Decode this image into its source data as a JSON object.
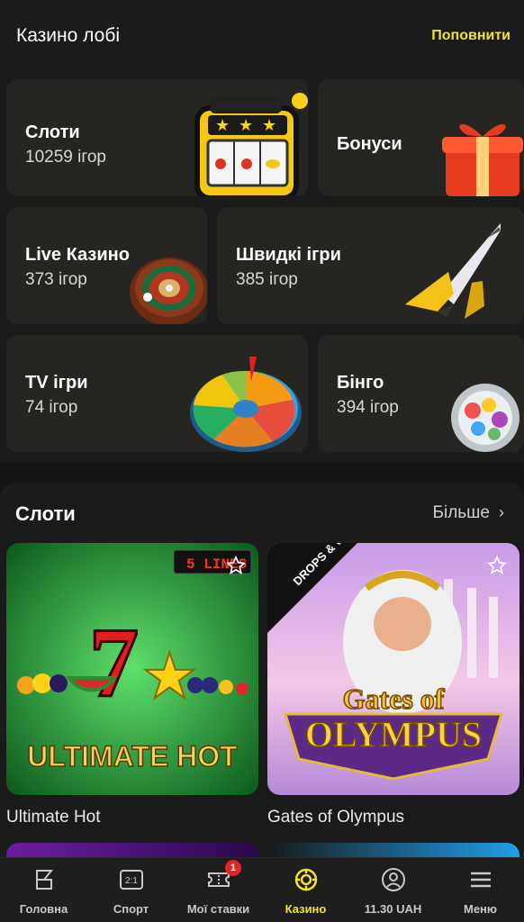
{
  "header": {
    "title": "Казино лобі",
    "topup_label": "Поповнити"
  },
  "categories": [
    {
      "name": "Слоти",
      "count": "10259 ігор",
      "icon": "slot-machine-icon"
    },
    {
      "name": "Бонуси",
      "count": "",
      "icon": "gift-icon"
    },
    {
      "name": "Live Казино",
      "count": "373 ігор",
      "icon": "roulette-icon"
    },
    {
      "name": "Швидкі ігри",
      "count": "385 ігор",
      "icon": "jet-icon"
    },
    {
      "name": "TV ігри",
      "count": "74 ігор",
      "icon": "wheel-of-fortune-icon"
    },
    {
      "name": "Бінго",
      "count": "394 ігор",
      "icon": "bingo-drum-icon"
    }
  ],
  "slots_section": {
    "title": "Слоти",
    "more_label": "Більше",
    "games": [
      {
        "name": "Ultimate Hot",
        "art_title": "ULTIMATE HOT",
        "lines_badge": "5 LINES"
      },
      {
        "name": "Gates of Olympus",
        "art_title_top": "Gates of",
        "art_title_bottom": "OLYMPUS",
        "promo_badge": "DROPS & WINS"
      }
    ]
  },
  "bottom_nav": {
    "items": [
      {
        "label": "Головна",
        "icon": "home-icon"
      },
      {
        "label": "Спорт",
        "icon": "scoreboard-icon"
      },
      {
        "label": "Мої ставки",
        "icon": "ticket-icon",
        "badge": "1"
      },
      {
        "label": "Казино",
        "icon": "casino-chip-icon",
        "active": true
      },
      {
        "label": "11.30 UAH",
        "icon": "account-icon"
      },
      {
        "label": "Меню",
        "icon": "menu-icon"
      }
    ]
  },
  "colors": {
    "accent": "#f4e22b",
    "background": "#141414",
    "card": "#272522",
    "badge": "#e0262b"
  }
}
